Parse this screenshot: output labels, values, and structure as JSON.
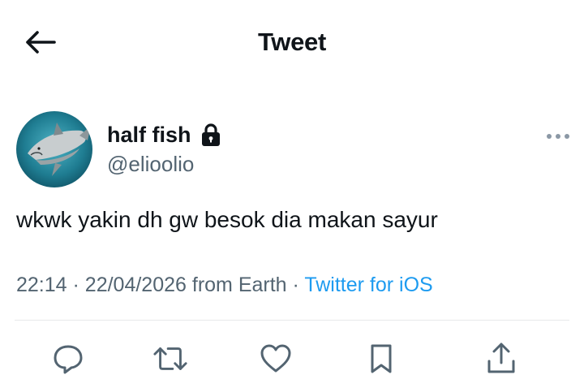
{
  "header": {
    "title": "Tweet",
    "back_icon": "arrow-left-icon"
  },
  "author": {
    "name": "half fish",
    "handle": "@elioolio",
    "protected_icon": "lock-icon",
    "avatar": "shark-photo-avatar"
  },
  "tweet": {
    "text": "wkwk yakin dh gw besok dia makan sayur",
    "time": "22:14",
    "separator": "·",
    "date": "22/04/2026",
    "location": "from Earth",
    "source": "Twitter for iOS"
  },
  "menu": {
    "icon": "more-horizontal-icon"
  },
  "actions": [
    {
      "name": "reply",
      "icon": "reply-icon"
    },
    {
      "name": "retweet",
      "icon": "retweet-icon"
    },
    {
      "name": "like",
      "icon": "heart-icon"
    },
    {
      "name": "bookmark",
      "icon": "bookmark-icon"
    },
    {
      "name": "share",
      "icon": "share-icon"
    }
  ],
  "colors": {
    "text": "#0f1419",
    "secondary": "#536471",
    "link": "#1d9bf0",
    "divider": "#e7e9ea"
  }
}
